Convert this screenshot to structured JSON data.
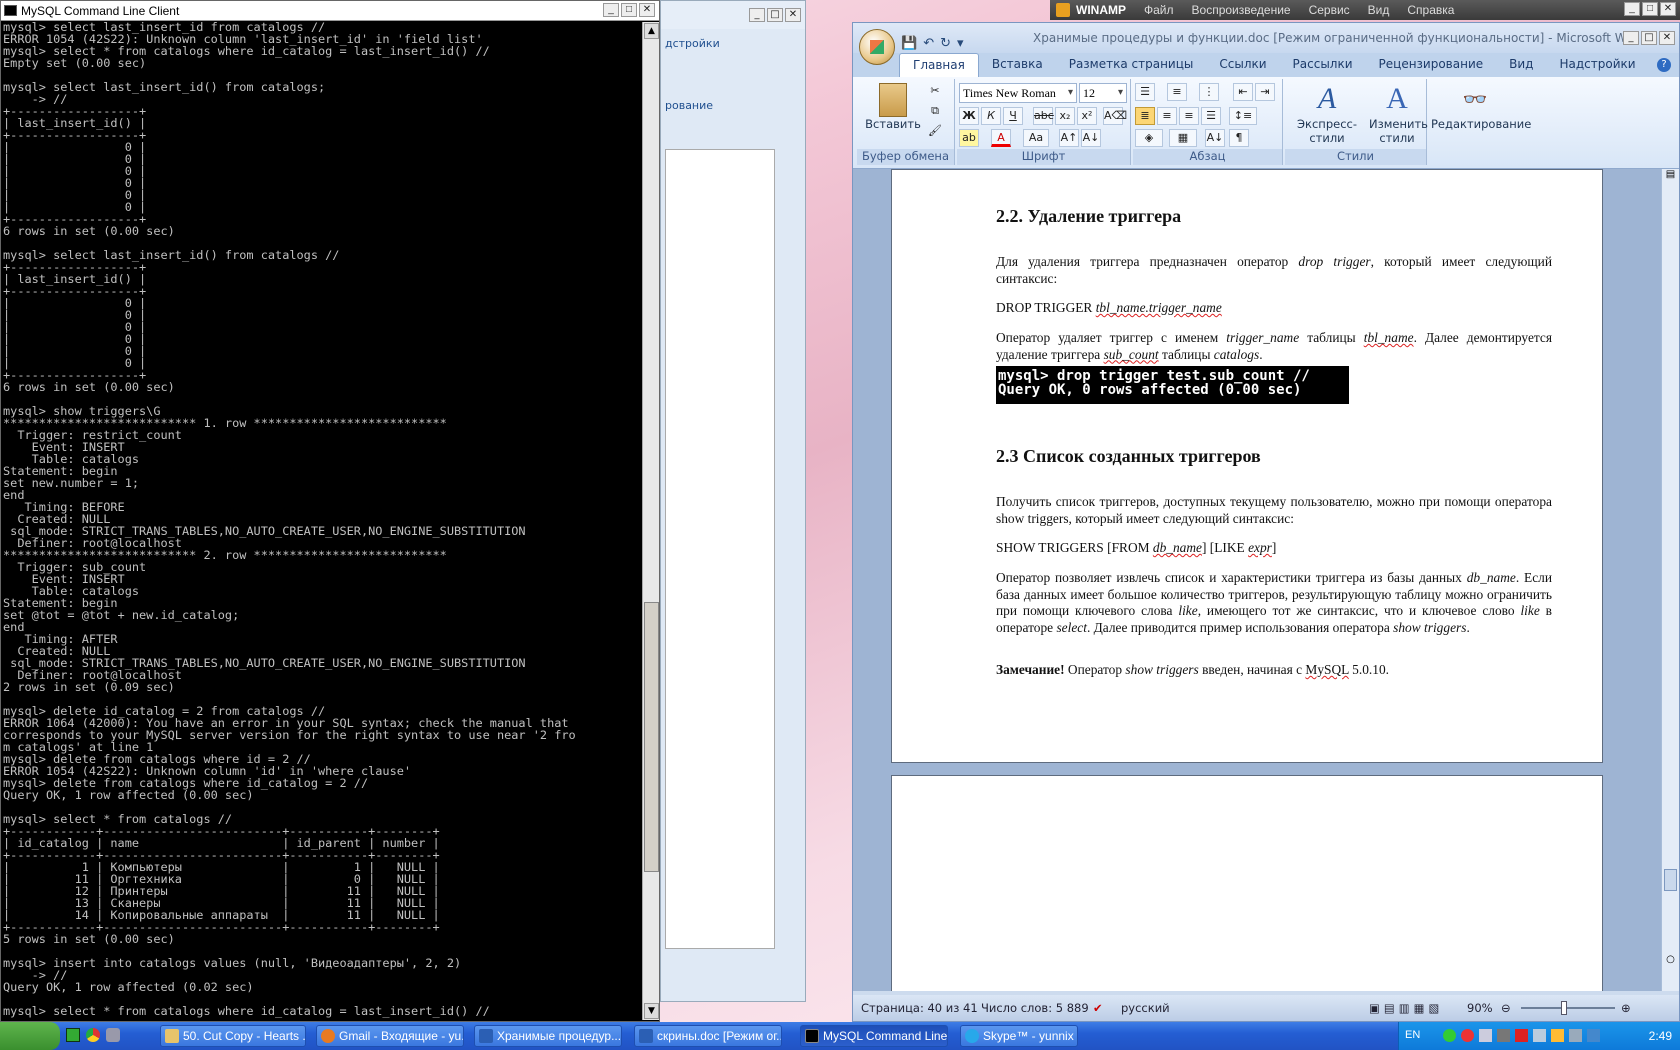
{
  "console": {
    "title": "MySQL Command Line Client",
    "text": "mysql> select last_insert_id from catalogs //\nERROR 1054 (42S22): Unknown column 'last_insert_id' in 'field list'\nmysql> select * from catalogs where id_catalog = last_insert_id() //\nEmpty set (0.00 sec)\n\nmysql> select last_insert_id() from catalogs;\n    -> //\n+------------------+\n| last_insert_id() |\n+------------------+\n|                0 |\n|                0 |\n|                0 |\n|                0 |\n|                0 |\n|                0 |\n+------------------+\n6 rows in set (0.00 sec)\n\nmysql> select last_insert_id() from catalogs //\n+------------------+\n| last_insert_id() |\n+------------------+\n|                0 |\n|                0 |\n|                0 |\n|                0 |\n|                0 |\n|                0 |\n+------------------+\n6 rows in set (0.00 sec)\n\nmysql> show triggers\\G\n*************************** 1. row ***************************\n  Trigger: restrict_count\n    Event: INSERT\n    Table: catalogs\nStatement: begin\nset new.number = 1;\nend\n   Timing: BEFORE\n  Created: NULL\n sql_mode: STRICT_TRANS_TABLES,NO_AUTO_CREATE_USER,NO_ENGINE_SUBSTITUTION\n  Definer: root@localhost\n*************************** 2. row ***************************\n  Trigger: sub_count\n    Event: INSERT\n    Table: catalogs\nStatement: begin\nset @tot = @tot + new.id_catalog;\nend\n   Timing: AFTER\n  Created: NULL\n sql_mode: STRICT_TRANS_TABLES,NO_AUTO_CREATE_USER,NO_ENGINE_SUBSTITUTION\n  Definer: root@localhost\n2 rows in set (0.09 sec)\n\nmysql> delete id_catalog = 2 from catalogs //\nERROR 1064 (42000): You have an error in your SQL syntax; check the manual that\ncorresponds to your MySQL server version for the right syntax to use near '2 fro\nm catalogs' at line 1\nmysql> delete from catalogs where id = 2 //\nERROR 1054 (42S22): Unknown column 'id' in 'where clause'\nmysql> delete from catalogs where id_catalog = 2 //\nQuery OK, 1 row affected (0.00 sec)\n\nmysql> select * from catalogs //\n+------------+-------------------------+-----------+--------+\n| id_catalog | name                    | id_parent | number |\n+------------+-------------------------+-----------+--------+\n|          1 | Компьютеры              |         1 |   NULL |\n|         11 | Оргтехника              |         0 |   NULL |\n|         12 | Принтеры                |        11 |   NULL |\n|         13 | Сканеры                 |        11 |   NULL |\n|         14 | Копировальные аппараты  |        11 |   NULL |\n+------------+-------------------------+-----------+--------+\n5 rows in set (0.00 sec)\n\nmysql> insert into catalogs values (null, 'Видеоадаптеры', 2, 2)\n    -> //\nQuery OK, 1 row affected (0.02 sec)\n\nmysql> select * from catalogs where id_catalog = last_insert_id() //"
  },
  "bgwin": {
    "label1": "дстройки",
    "label2": "рование"
  },
  "winamp": {
    "title": "WINAMP",
    "menu": [
      "Файл",
      "Воспроизведение",
      "Сервис",
      "Вид",
      "Справка"
    ]
  },
  "word": {
    "title": "Хранимые процедуры и функции.doc [Режим ограниченной функциональности] - Microsoft W...",
    "tabs": [
      "Главная",
      "Вставка",
      "Разметка страницы",
      "Ссылки",
      "Рассылки",
      "Рецензирование",
      "Вид",
      "Надстройки"
    ],
    "ribbon": {
      "paste": "Вставить",
      "clipboard": "Буфер обмена",
      "font_name": "Times New Roman",
      "font_size": "12",
      "font_group": "Шрифт",
      "paragraph_group": "Абзац",
      "express_styles": "Экспресс-стили",
      "change_styles_1": "Изменить",
      "change_styles_2": "стили",
      "styles_group": "Стили",
      "editing": "Редактирование"
    },
    "doc": {
      "h22": "2.2. Удаление триггера",
      "p1_a": "Для удаления триггера предназначен оператор ",
      "p1_i": "drop trigger",
      "p1_b": ", который имеет следующий синтаксис:",
      "syntax1_a": "DROP TRIGGER ",
      "syntax1_i": "tbl_name.trigger_name",
      "p2_a": "Оператор удаляет триггер с именем ",
      "p2_i1": "trigger_name",
      "p2_b": " таблицы ",
      "p2_i2": "tbl_name",
      "p2_c": ". Далее демонтируется удаление триггера ",
      "p2_i3": "sub_count",
      "p2_d": " таблицы ",
      "p2_i4": "catalogs",
      "p2_e": ".",
      "cmd_line1": "mysql> drop trigger test.sub_count //",
      "cmd_line2": "Query OK, 0 rows affected (0.00 sec)",
      "h23": "2.3 Список созданных триггеров",
      "p3": "Получить список триггеров, доступных текущему пользователю, можно при помощи оператора show triggers, который имеет следующий синтаксис:",
      "syntax2_a": "SHOW TRIGGERS [FROM ",
      "syntax2_i1": "db_name",
      "syntax2_b": "] [LIKE ",
      "syntax2_i2": "expr",
      "syntax2_c": "]",
      "p4_a": "Оператор позволяет извлечь список и характеристики триггера из базы данных ",
      "p4_i1": "db_name",
      "p4_b": ". Если база данных имеет большое количество триггеров, результирующую таблицу можно ограничить при помощи ключевого слова ",
      "p4_i2": "like",
      "p4_c": ", имеющего тот же синтаксис, что и ключевое слово ",
      "p4_i3": "like",
      "p4_d": " в операторе ",
      "p4_i4": "select",
      "p4_e": ". Далее приводится пример использования оператора ",
      "p4_i5": "show triggers",
      "p4_f": ".",
      "note_b": "Замечание!",
      "note_a": " Оператор ",
      "note_i": "show triggers",
      "note_c": " введен, начиная с ",
      "note_s": "MySQL",
      "note_d": " 5.0.10."
    },
    "status": {
      "page": "Страница: 40 из 41",
      "words": "Число слов: 5 889",
      "lang": "русский",
      "zoom": "90%"
    }
  },
  "taskbar": {
    "buttons": [
      "50. Cut Copy - Hearts ...",
      "Gmail - Входящие - yu...",
      "Хранимые процедур...",
      "скрины.doc [Режим ог...",
      "MySQL Command Line ...",
      "Skype™ - yunnix"
    ],
    "tray_lang": "EN",
    "clock": "2:49"
  }
}
